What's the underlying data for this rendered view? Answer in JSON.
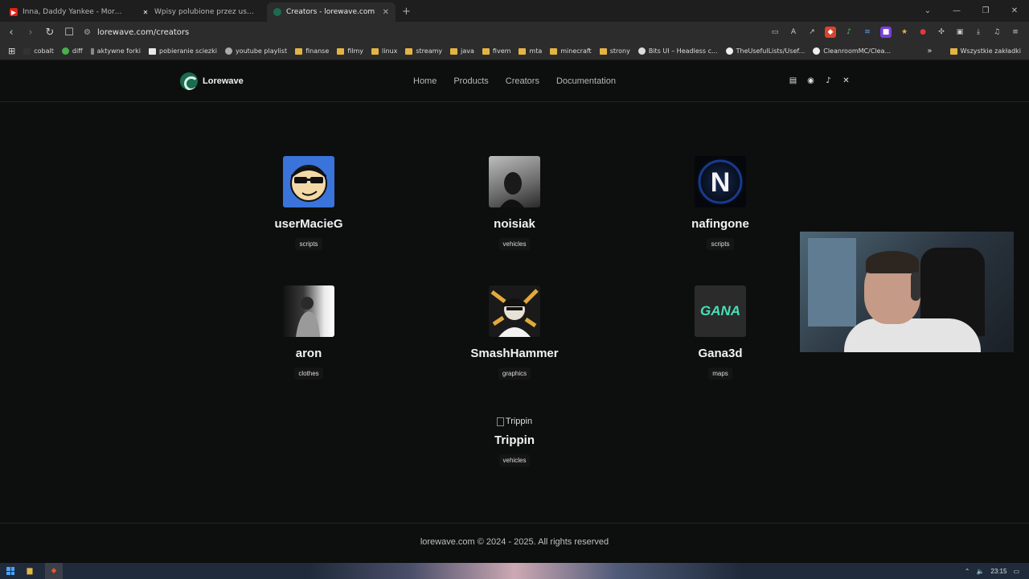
{
  "browser": {
    "tabs": [
      {
        "title": "Inna, Daddy Yankee - More Than",
        "favicon": "youtube-icon",
        "active": false
      },
      {
        "title": "Wpisy polubione przez usermacieg",
        "favicon": "x-icon",
        "active": false
      },
      {
        "title": "Creators - lorewave.com",
        "favicon": "lorewave-icon",
        "active": true
      }
    ],
    "url": "lorewave.com/creators",
    "bookmarks": [
      "cobalt",
      "diff",
      "aktywne forki",
      "pobieranie sciezki",
      "youtube playlist",
      "finanse",
      "filmy",
      "linux",
      "streamy",
      "java",
      "fivem",
      "mta",
      "minecraft",
      "strony",
      "Bits UI – Headless c...",
      "TheUsefulLists/Usef...",
      "CleanroomMC/Clea..."
    ],
    "bookmarks_other": "Wszystkie zakładki"
  },
  "site": {
    "logo_text": "Lorewave",
    "nav": [
      "Home",
      "Products",
      "Creators",
      "Documentation"
    ],
    "social_icons": [
      "store-icon",
      "discord-icon",
      "tiktok-icon",
      "x-icon"
    ],
    "creators": [
      {
        "name": "userMacieG",
        "tag": "scripts"
      },
      {
        "name": "noisiak",
        "tag": "vehicles"
      },
      {
        "name": "nafingone",
        "tag": "scripts"
      },
      {
        "name": "aron",
        "tag": "clothes"
      },
      {
        "name": "SmashHammer",
        "tag": "graphics"
      },
      {
        "name": "Gana3d",
        "tag": "maps"
      },
      {
        "name": "Trippin",
        "tag": "vehicles",
        "image_alt": "Trippin"
      }
    ],
    "gana_logo_text": "GANA",
    "nafingone_logo_text": "N",
    "footer": "lorewave.com © 2024 - 2025. All rights reserved"
  },
  "taskbar": {
    "time": "23:15"
  },
  "colors": {
    "background": "#0d0e0e",
    "accent": "#1b6b4e",
    "gana": "#46e0b8"
  }
}
